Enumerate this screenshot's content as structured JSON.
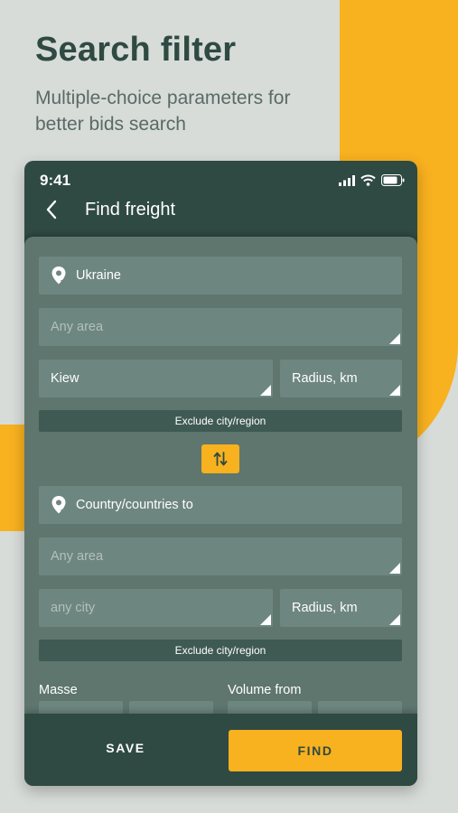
{
  "hero": {
    "title": "Search filter",
    "subtitle": "Multiple-choice parameters for better bids search"
  },
  "status_bar": {
    "time": "9:41",
    "icons": [
      "signal-icon",
      "wifi-icon",
      "battery-icon"
    ]
  },
  "app_bar": {
    "back_icon": "chevron-left-icon",
    "title": "Find freight"
  },
  "from": {
    "country": {
      "value": "Ukraine",
      "icon": "location-pin-icon"
    },
    "area": {
      "placeholder": "Any area"
    },
    "city": {
      "value": "Kiew"
    },
    "radius": {
      "value": "Radius, km"
    },
    "exclude_label": "Exclude city/region"
  },
  "swap_button": {
    "icon": "swap-vertical-icon"
  },
  "to": {
    "country": {
      "placeholder": "Country/countries to",
      "icon": "location-pin-icon"
    },
    "area": {
      "placeholder": "Any area"
    },
    "city": {
      "placeholder": "any city"
    },
    "radius": {
      "value": "Radius, km"
    },
    "exclude_label": "Exclude city/region"
  },
  "cargo": {
    "mass_label": "Masse",
    "volume_label": "Volume from"
  },
  "actions": {
    "save_label": "SAVE",
    "find_label": "FIND"
  },
  "colors": {
    "accent": "#f8b11f",
    "dark_green": "#2f4a42",
    "form_bg": "#5e766e",
    "field_bg": "#6e8680",
    "page_bg": "#d7dcd9"
  }
}
